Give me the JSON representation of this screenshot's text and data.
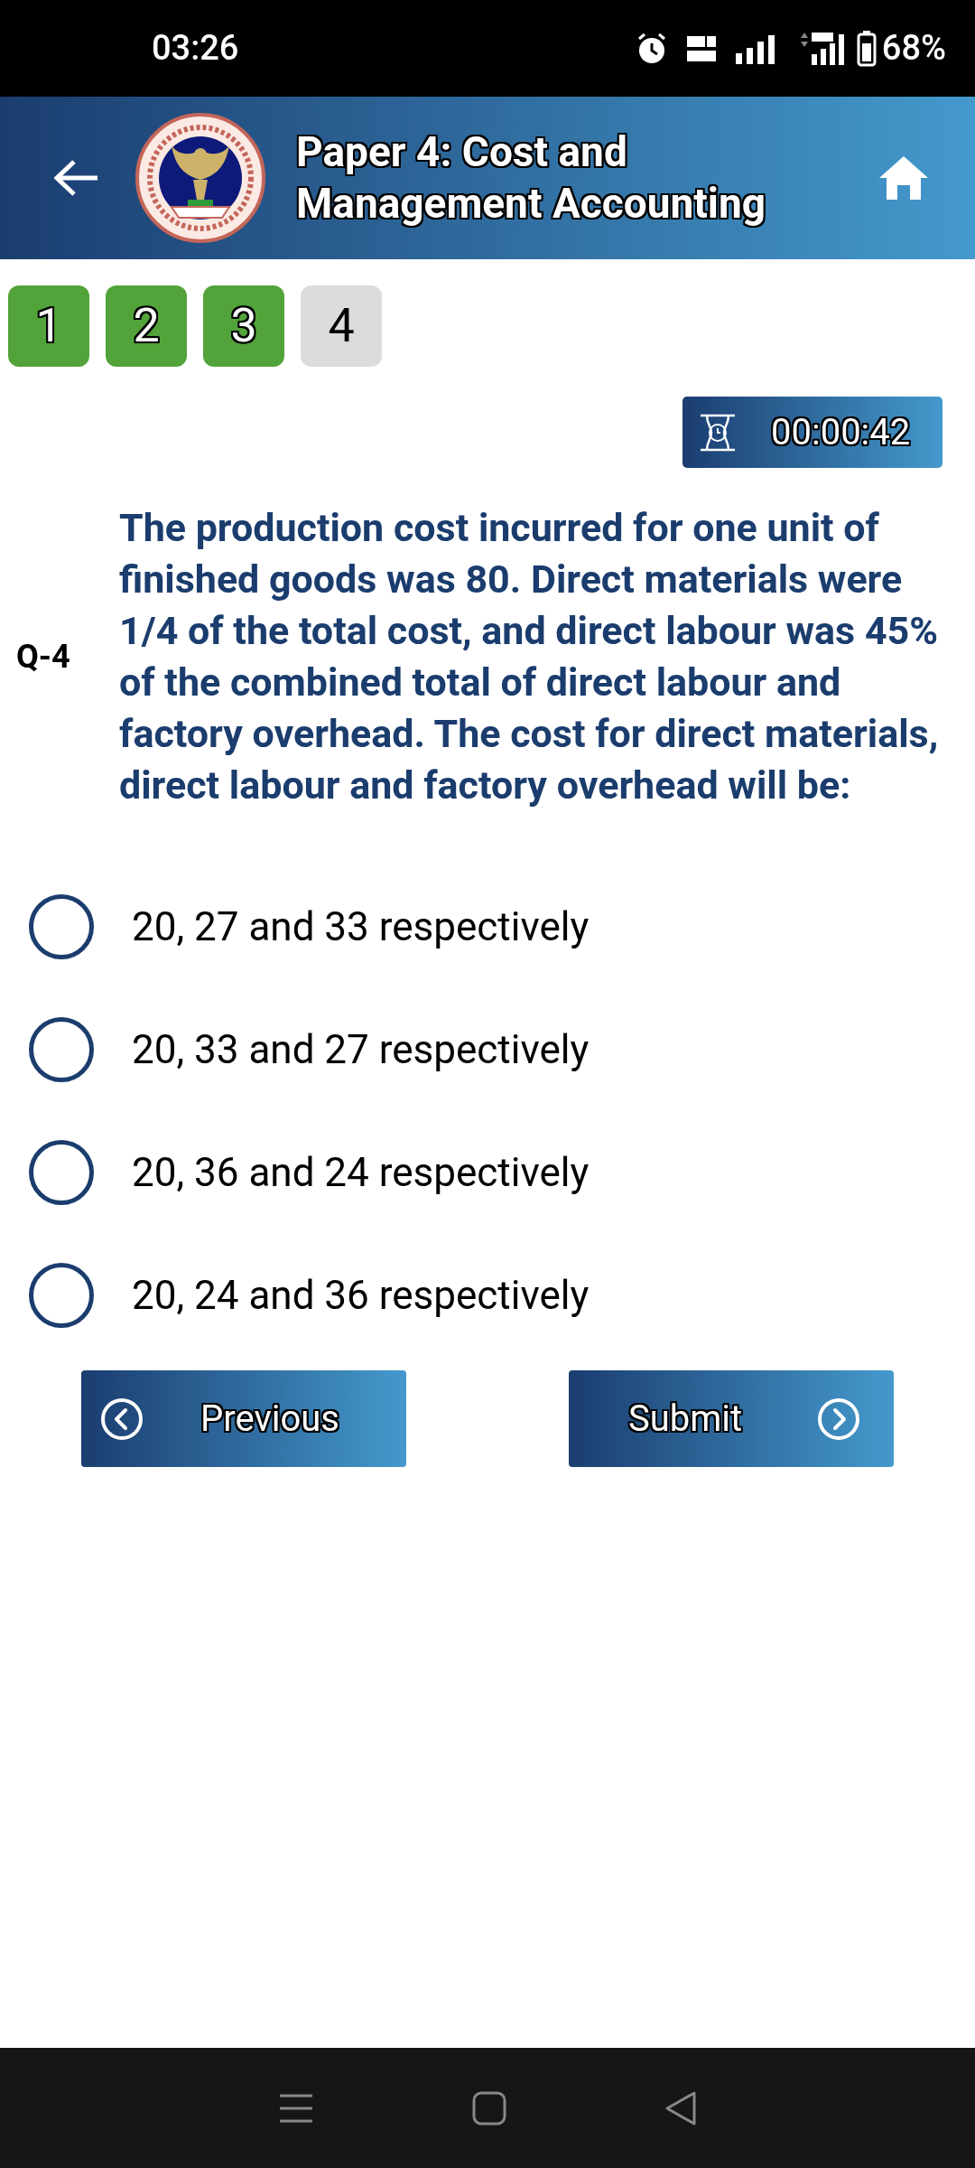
{
  "status_bar": {
    "time": "03:26",
    "battery": "68%"
  },
  "header": {
    "title": "Paper 4: Cost and Management Accounting"
  },
  "question_tabs": [
    {
      "label": "1",
      "answered": true
    },
    {
      "label": "2",
      "answered": true
    },
    {
      "label": "3",
      "answered": true
    },
    {
      "label": "4",
      "answered": false
    }
  ],
  "timer": {
    "time": "00:00:42"
  },
  "question": {
    "number": "Q-4",
    "text": "The production cost incurred for one unit of finished goods was 80. Direct materials were 1/4 of the total cost, and direct labour was 45% of the combined total of direct labour and factory overhead. The cost for direct materials, direct labour and factory overhead will be:"
  },
  "options": [
    {
      "label": "20, 27 and 33 respectively",
      "selected": false
    },
    {
      "label": "20, 33 and 27 respectively",
      "selected": false
    },
    {
      "label": "20, 36 and 24 respectively",
      "selected": false
    },
    {
      "label": "20, 24 and 36 respectively",
      "selected": false
    }
  ],
  "buttons": {
    "previous": "Previous",
    "submit": "Submit"
  }
}
